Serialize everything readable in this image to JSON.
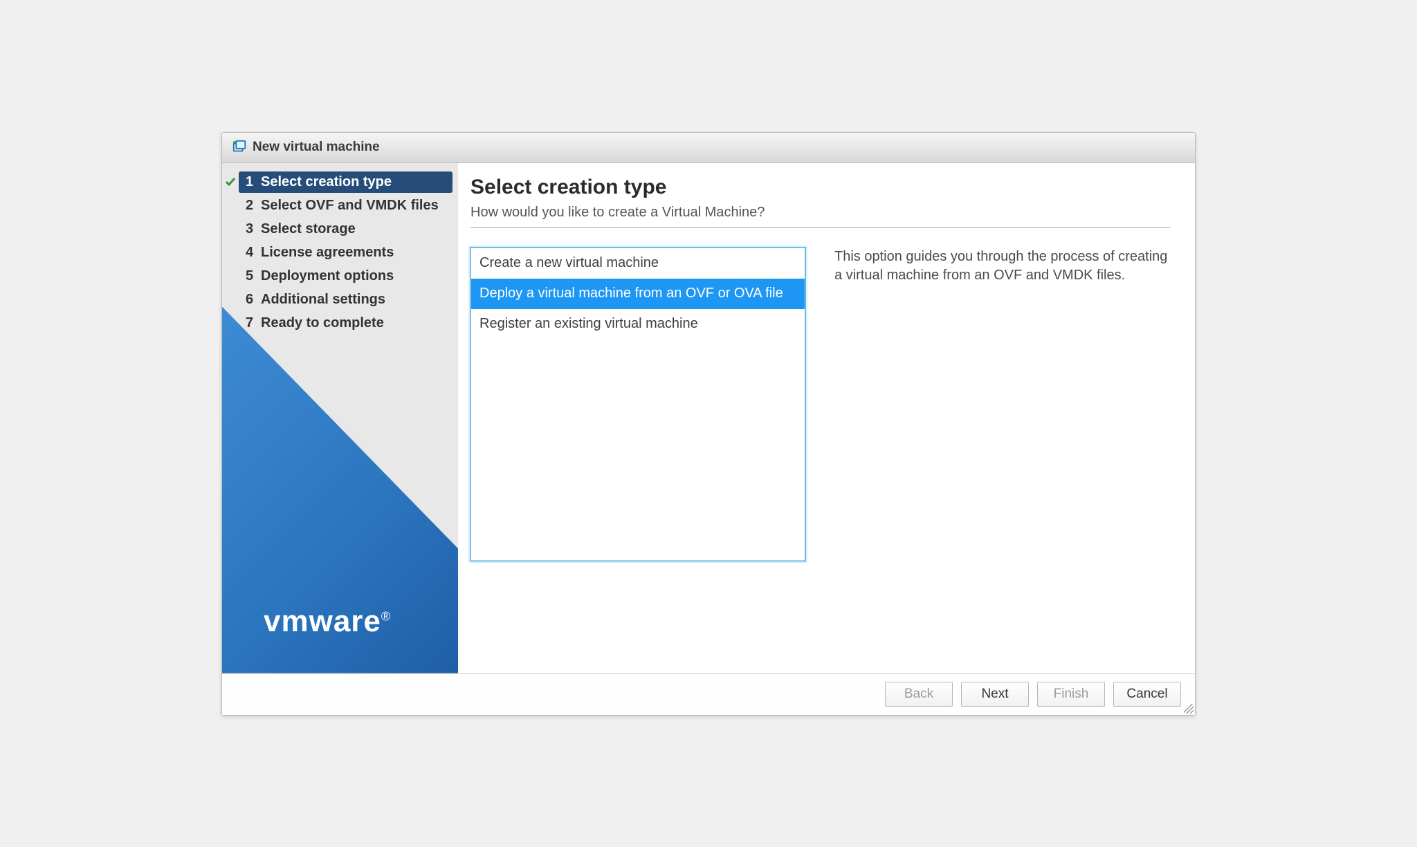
{
  "window": {
    "title": "New virtual machine"
  },
  "sidebar": {
    "steps": [
      {
        "num": "1",
        "label": "Select creation type",
        "active": true,
        "completed": true
      },
      {
        "num": "2",
        "label": "Select OVF and VMDK files",
        "active": false,
        "completed": false
      },
      {
        "num": "3",
        "label": "Select storage",
        "active": false,
        "completed": false
      },
      {
        "num": "4",
        "label": "License agreements",
        "active": false,
        "completed": false
      },
      {
        "num": "5",
        "label": "Deployment options",
        "active": false,
        "completed": false
      },
      {
        "num": "6",
        "label": "Additional settings",
        "active": false,
        "completed": false
      },
      {
        "num": "7",
        "label": "Ready to complete",
        "active": false,
        "completed": false
      }
    ],
    "brand": "vmware"
  },
  "main": {
    "title": "Select creation type",
    "subtitle": "How would you like to create a Virtual Machine?",
    "options": [
      {
        "label": "Create a new virtual machine",
        "selected": false
      },
      {
        "label": "Deploy a virtual machine from an OVF or OVA file",
        "selected": true
      },
      {
        "label": "Register an existing virtual machine",
        "selected": false
      }
    ],
    "description": "This option guides you through the process of creating a virtual machine from an OVF and VMDK files."
  },
  "footer": {
    "back": {
      "label": "Back",
      "enabled": false
    },
    "next": {
      "label": "Next",
      "enabled": true
    },
    "finish": {
      "label": "Finish",
      "enabled": false
    },
    "cancel": {
      "label": "Cancel",
      "enabled": true
    }
  },
  "colors": {
    "sidebar_active": "#264d7a",
    "option_selected": "#1d97f3",
    "check_green": "#2e9a3a"
  }
}
